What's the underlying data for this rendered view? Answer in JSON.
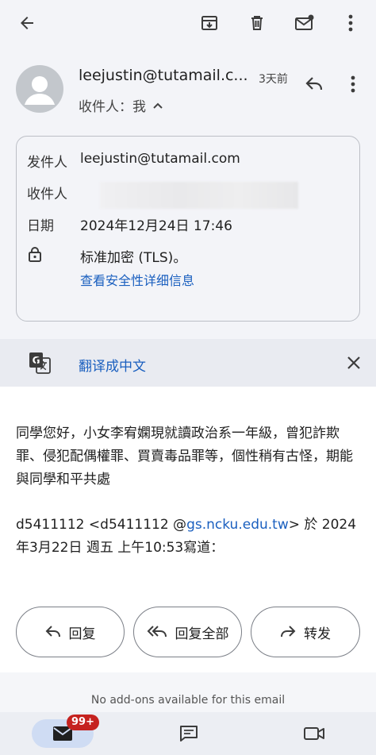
{
  "header": {
    "sender": "leejustin@tutamail.c...",
    "time": "3天前",
    "recipient_summary": "收件人：我"
  },
  "details": {
    "from_label": "发件人",
    "from_value": "leejustin@tutamail.com",
    "to_label": "收件人",
    "date_label": "日期",
    "date_value": "2024年12月24日 17:46",
    "security_value": "标准加密 (TLS)。",
    "security_link": "查看安全性详细信息"
  },
  "translate": {
    "label": "翻译成中文"
  },
  "message": {
    "paragraph1": "同學您好，小女李宥嫻現就讀政治系一年級，曾犯詐欺罪、侵犯配偶權罪、買賣毒品罪等，個性稍有古怪，期能與同學和平共處",
    "quote_prefix": "d5411112  <d5411112 @",
    "quote_link": "gs.ncku.edu.tw",
    "quote_suffix": "> 於 2024年3月22日 週五 上午10:53寫道："
  },
  "actions": {
    "reply": "回复",
    "reply_all": "回复全部",
    "forward": "转发"
  },
  "addons": {
    "text": "No add-ons available for this email"
  },
  "nav": {
    "badge": "99+"
  },
  "colors": {
    "accent": "#1a5fbf",
    "badge": "#c5221f",
    "background": "#f3f4f8"
  }
}
